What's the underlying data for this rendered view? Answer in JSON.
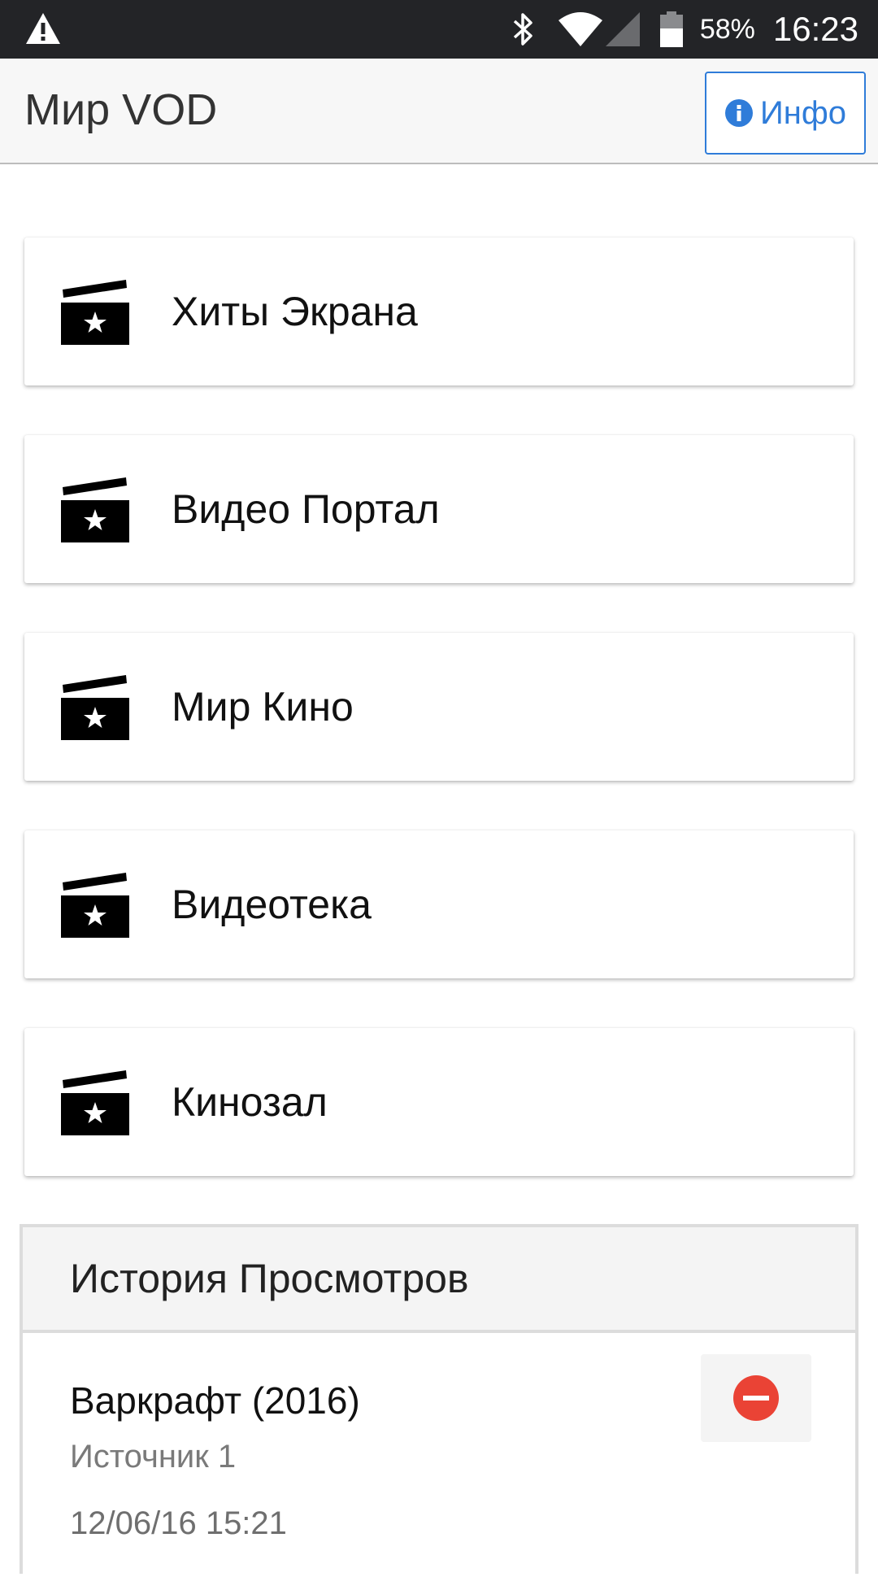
{
  "status_bar": {
    "battery_percent": "58%",
    "time": "16:23",
    "icons": [
      "warning-icon",
      "bluetooth-icon",
      "wifi-icon",
      "cell-signal-icon",
      "battery-icon"
    ]
  },
  "app_bar": {
    "title": "Мир VOD",
    "info_label": "Инфо",
    "accent_color": "#2f7cd9"
  },
  "menu": {
    "items": [
      {
        "label": "Хиты Экрана",
        "icon": "clapperboard-icon"
      },
      {
        "label": "Видео Портал",
        "icon": "clapperboard-icon"
      },
      {
        "label": "Мир Кино",
        "icon": "clapperboard-icon"
      },
      {
        "label": "Видеотека",
        "icon": "clapperboard-icon"
      },
      {
        "label": "Кинозал",
        "icon": "clapperboard-icon"
      }
    ]
  },
  "history": {
    "title": "История Просмотров",
    "items": [
      {
        "title": "Варкрафт (2016)",
        "source": "Источник 1",
        "date": "12/06/16 15:21",
        "remove_color": "#ea4335"
      }
    ]
  }
}
